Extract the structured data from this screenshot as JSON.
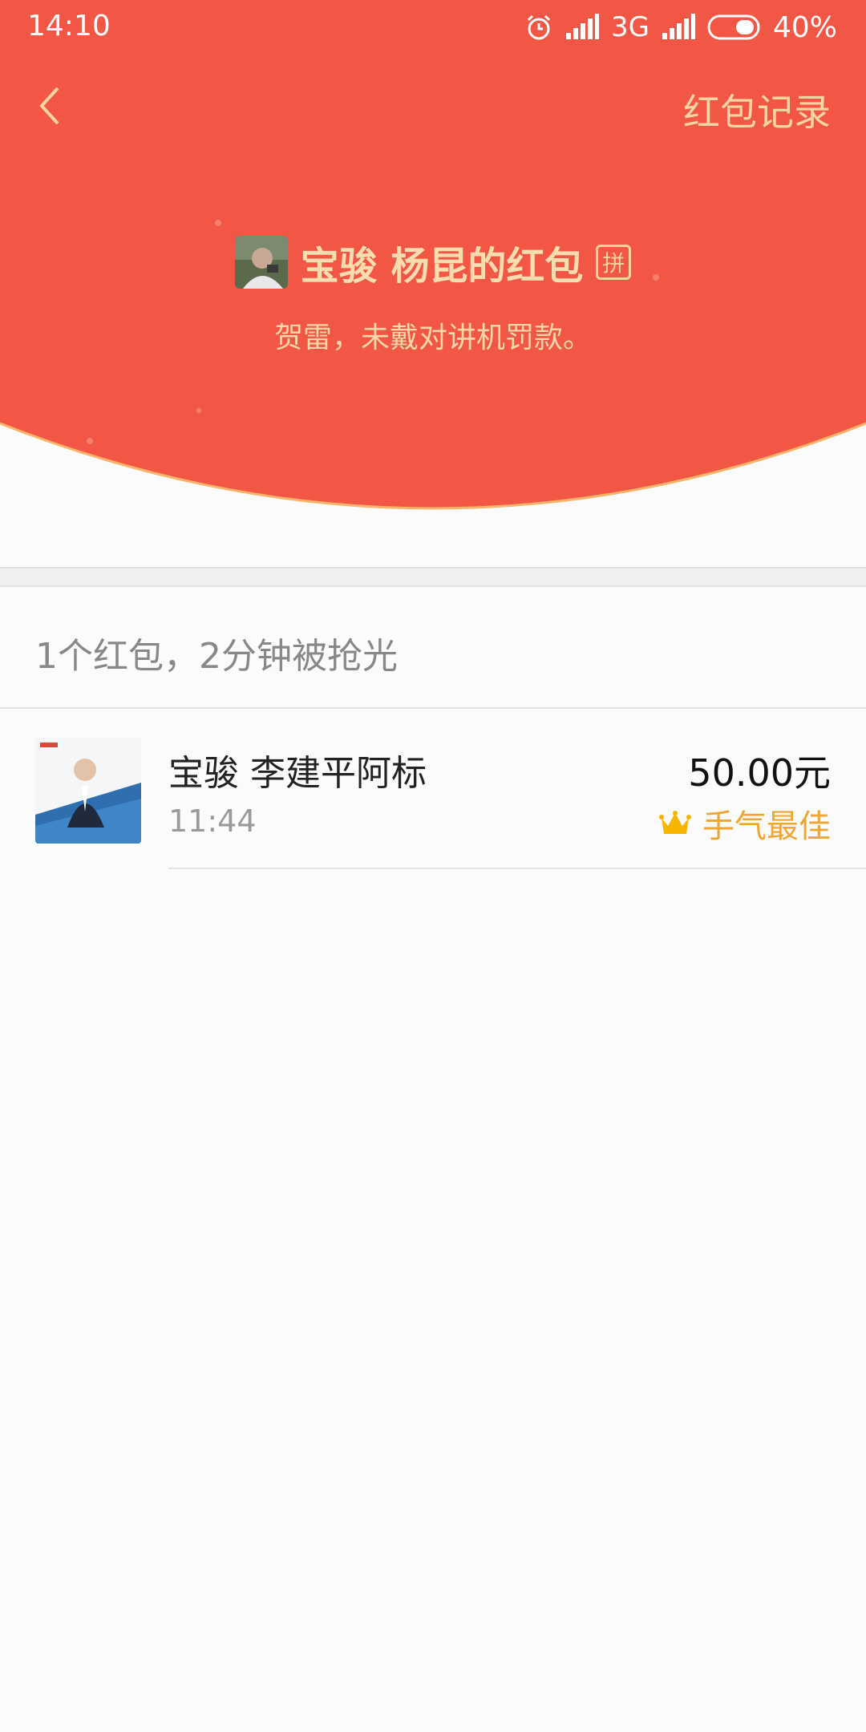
{
  "status_bar": {
    "time": "14:10",
    "network": "3G",
    "battery": "40%",
    "icons": [
      "alarm-icon",
      "signal-icon",
      "battery-icon"
    ]
  },
  "header": {
    "back_icon": "chevron-left-icon",
    "records_label": "红包记录"
  },
  "packet": {
    "sender_title": "宝骏 杨昆的红包",
    "pin_badge": "拼",
    "blessing": "贺雷，未戴对讲机罚款。"
  },
  "summary": "1个红包，2分钟被抢光",
  "receivers": [
    {
      "name": "宝骏 李建平阿标",
      "time": "11:44",
      "amount": "50.00元",
      "badge": "手气最佳",
      "badge_icon": "crown-icon"
    }
  ],
  "colors": {
    "header_red": "#f25645",
    "gold_text": "#f8d4a4",
    "best_luck": "#f0a633",
    "background": "#fbfbfb"
  }
}
